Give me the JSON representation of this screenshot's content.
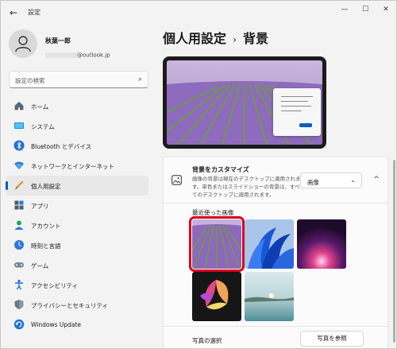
{
  "window": {
    "app_title": "設定",
    "back_glyph": "←",
    "minimize_glyph": "—",
    "maximize_glyph": "☐",
    "close_glyph": "✕"
  },
  "user": {
    "name": "秋葉一郎",
    "email_suffix": "@outlook.jp"
  },
  "search": {
    "placeholder": "設定の検索",
    "icon": "search-icon"
  },
  "sidebar": {
    "items": [
      {
        "label": "ホーム",
        "icon": "home-icon"
      },
      {
        "label": "システム",
        "icon": "system-icon"
      },
      {
        "label": "Bluetooth とデバイス",
        "icon": "bluetooth-icon"
      },
      {
        "label": "ネットワークとインターネット",
        "icon": "network-icon"
      },
      {
        "label": "個人用設定",
        "icon": "personalization-icon",
        "active": true
      },
      {
        "label": "アプリ",
        "icon": "apps-icon"
      },
      {
        "label": "アカウント",
        "icon": "account-icon"
      },
      {
        "label": "時刻と言語",
        "icon": "time-language-icon"
      },
      {
        "label": "ゲーム",
        "icon": "gaming-icon"
      },
      {
        "label": "アクセシビリティ",
        "icon": "accessibility-icon"
      },
      {
        "label": "プライバシーとセキュリティ",
        "icon": "privacy-icon"
      },
      {
        "label": "Windows Update",
        "icon": "windows-update-icon"
      }
    ]
  },
  "header": {
    "parent": "個人用設定",
    "separator": "›",
    "current": "背景"
  },
  "background": {
    "title": "背景をカスタマイズ",
    "description": "画像の背景は現在のデスクトップに適用されます。単色またはスライドショーの背景は、すべてのデスクトップに適用されます。",
    "type_value": "画像",
    "chevron_down": "⌄",
    "collapse_glyph": "^",
    "recent_label": "最近使った画像",
    "choose_photo_label": "写真の選択",
    "browse_button": "写真を参照"
  },
  "colors": {
    "accent": "#005fb8",
    "selection_outline": "#d9001b"
  }
}
